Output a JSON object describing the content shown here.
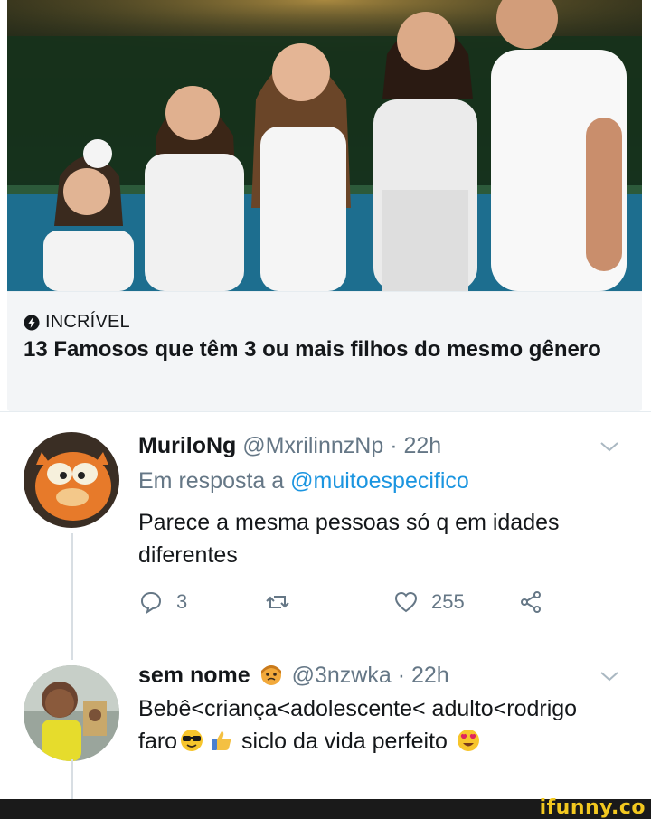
{
  "card": {
    "source": "INCRÍVEL",
    "title": "13 Famosos que têm 3 ou mais filhos do mesmo gênero",
    "source_icon": "lightning-icon"
  },
  "tweets": [
    {
      "name": "MuriloNg",
      "handle": "@MxrilinnzNp",
      "time": "· 22h",
      "reply_prefix": "Em resposta a",
      "reply_mention": "@muitoespecifico",
      "text": "Parece a mesma pessoas só q em idades diferentes",
      "actions": {
        "replies": "3",
        "retweets": "",
        "likes": "255"
      }
    },
    {
      "name": "sem nome",
      "handle": "@3nzwka",
      "time": "· 22h",
      "text_part1": "Bebê<criança<adolescente< adulto<rodrigo faro",
      "text_part2": "siclo da vida perfeito"
    }
  ],
  "footer": {
    "watermark": "ifunny.co"
  },
  "colors": {
    "text": "#14171a",
    "secondary": "#657786",
    "link": "#1b95e0",
    "watermark": "#f2c81f"
  }
}
